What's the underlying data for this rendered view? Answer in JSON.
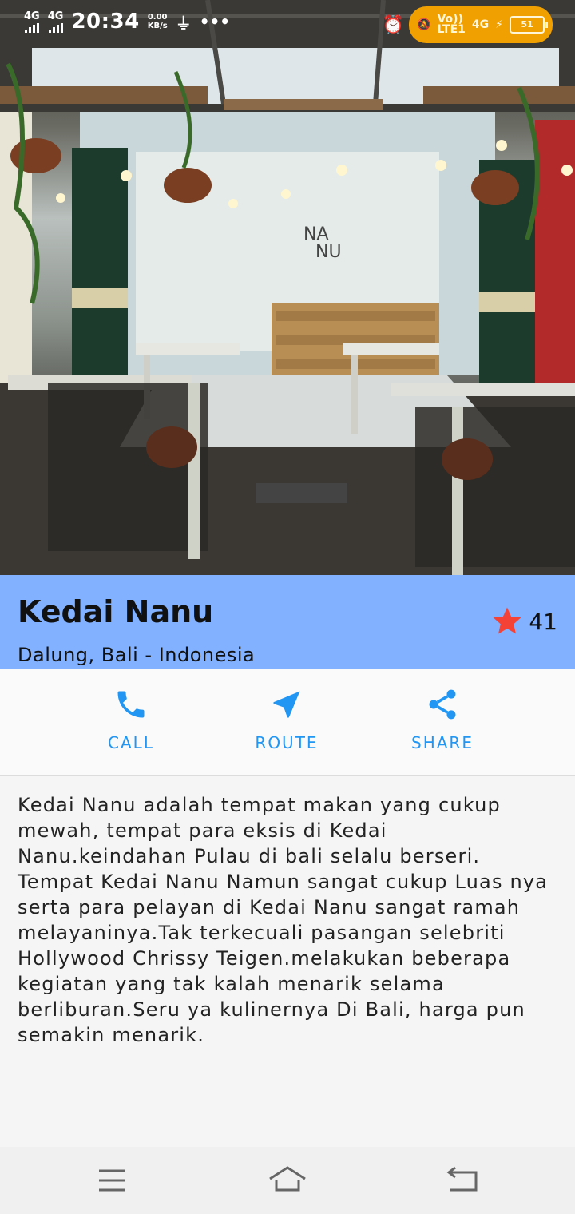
{
  "status_bar": {
    "network1": "4G",
    "network2": "4G",
    "time": "20:34",
    "speed_value": "0.00",
    "speed_unit": "KB/s",
    "volte": "Vo))",
    "lte": "LTE1",
    "network3": "4G",
    "battery": "51"
  },
  "place": {
    "name": "Kedai Nanu",
    "location": "Dalung, Bali - Indonesia",
    "rating": "41",
    "star_color": "#f44336"
  },
  "actions": [
    {
      "label": "CALL",
      "icon": "phone-icon"
    },
    {
      "label": "ROUTE",
      "icon": "navigation-icon"
    },
    {
      "label": "SHARE",
      "icon": "share-icon"
    }
  ],
  "description": "Kedai Nanu adalah tempat makan yang cukup mewah, tempat para eksis di Kedai Nanu.keindahan Pulau di bali selalu berseri. Tempat Kedai Nanu Namun sangat cukup Luas nya serta para pelayan di Kedai Nanu sangat ramah melayaninya.Tak terkecuali pasangan selebriti Hollywood Chrissy Teigen.melakukan beberapa kegiatan yang tak kalah menarik selama berliburan.Seru ya kulinernya Di Bali, harga pun semakin menarik.",
  "colors": {
    "accent": "#2196f3",
    "title_band": "#82b1ff",
    "notification_pill": "#f0a000"
  },
  "nav": {
    "menu_icon": "menu-icon",
    "home_icon": "home-icon",
    "back_icon": "back-icon"
  }
}
